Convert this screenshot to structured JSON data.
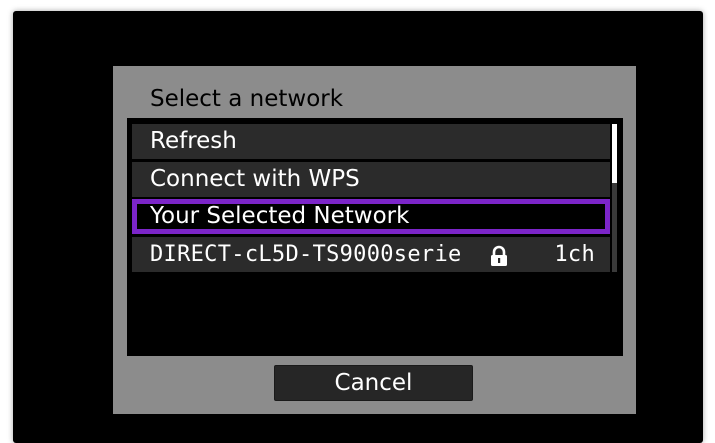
{
  "dialog": {
    "title": "Select a network",
    "cancel_label": "Cancel"
  },
  "network_list": {
    "items": [
      {
        "label": "Refresh",
        "selected": false
      },
      {
        "label": "Connect with WPS",
        "selected": false
      },
      {
        "label": "Your Selected Network",
        "selected": true
      },
      {
        "label": "DIRECT-cL5D-TS9000serie",
        "secured": true,
        "icon": "lock-icon",
        "channel": "1ch",
        "selected": false
      }
    ],
    "scrollbar": {
      "position_fraction": 0.0,
      "visible_fraction": 0.4
    }
  },
  "colors": {
    "screen_bg": "#000000",
    "dialog_bg": "#8c8c8c",
    "row_bg": "#2b2b2b",
    "selection_accent": "#7c25c9",
    "text": "#ffffff"
  }
}
